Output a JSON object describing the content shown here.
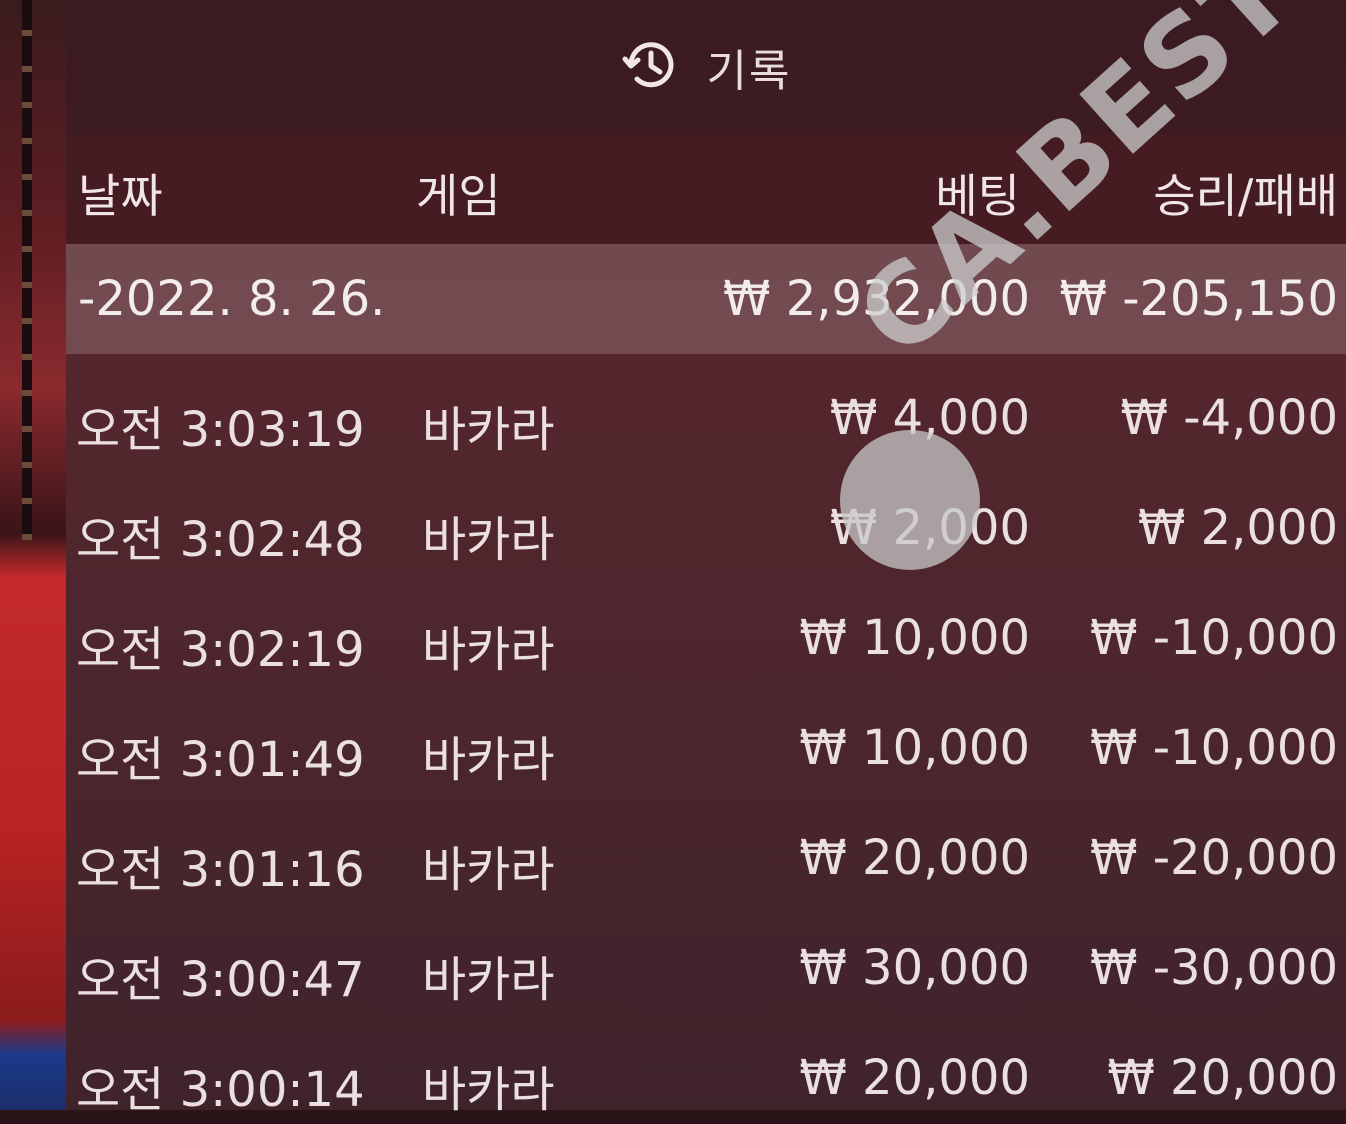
{
  "panel": {
    "title": "기록",
    "title_icon": "history-icon"
  },
  "table": {
    "headers": {
      "date": "날짜",
      "game": "게임",
      "bet": "베팅",
      "result": "승리/패배"
    },
    "summary": {
      "date": "-2022. 8. 26.",
      "bet": "₩ 2,932,000",
      "result": "₩ -205,150"
    },
    "rows": [
      {
        "time": "오전 3:03:19",
        "game": "바카라",
        "bet": "₩ 4,000",
        "result": "₩ -4,000"
      },
      {
        "time": "오전 3:02:48",
        "game": "바카라",
        "bet": "₩ 2,000",
        "result": "₩ 2,000"
      },
      {
        "time": "오전 3:02:19",
        "game": "바카라",
        "bet": "₩ 10,000",
        "result": "₩ -10,000"
      },
      {
        "time": "오전 3:01:49",
        "game": "바카라",
        "bet": "₩ 10,000",
        "result": "₩ -10,000"
      },
      {
        "time": "오전 3:01:16",
        "game": "바카라",
        "bet": "₩ 20,000",
        "result": "₩ -20,000"
      },
      {
        "time": "오전 3:00:47",
        "game": "바카라",
        "bet": "₩ 30,000",
        "result": "₩ -30,000"
      },
      {
        "time": "오전 3:00:14",
        "game": "바카라",
        "bet": "₩ 20,000",
        "result": "₩ 20,000"
      }
    ]
  },
  "watermark": {
    "text": "CA.BEST"
  },
  "colors": {
    "panel_bg": "#4a252b",
    "text": "#ebe0e1",
    "summary_bg": "#7a5a60"
  }
}
